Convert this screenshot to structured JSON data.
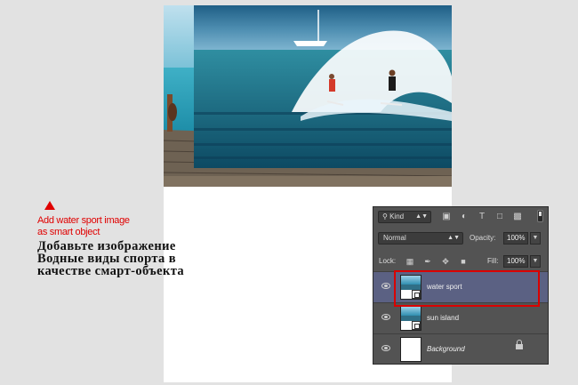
{
  "annotation": {
    "line1": "Add water sport image",
    "line2": "as smart object",
    "ru1": "Добавьте изображение",
    "ru2": "Водные виды спорта в",
    "ru3": "качестве смарт-объекта",
    "arrow_color": "#e00000"
  },
  "layers_panel": {
    "filter_kind": "Kind",
    "filter_icons": [
      "image-filter-icon",
      "adjustment-filter-icon",
      "type-filter-icon",
      "shape-filter-icon",
      "smart-object-filter-icon"
    ],
    "type_icon_glyph": "T",
    "blend_mode": "Normal",
    "opacity_label": "Opacity:",
    "opacity_value": "100%",
    "lock_label": "Lock:",
    "fill_label": "Fill:",
    "fill_value": "100%",
    "layers": [
      {
        "name": "water sport",
        "selected": true,
        "visible": true,
        "smart_object": true
      },
      {
        "name": "sun island",
        "selected": false,
        "visible": true,
        "smart_object": true
      },
      {
        "name": "Background",
        "selected": false,
        "visible": true,
        "locked": true
      }
    ],
    "highlight_color": "#d90000"
  }
}
